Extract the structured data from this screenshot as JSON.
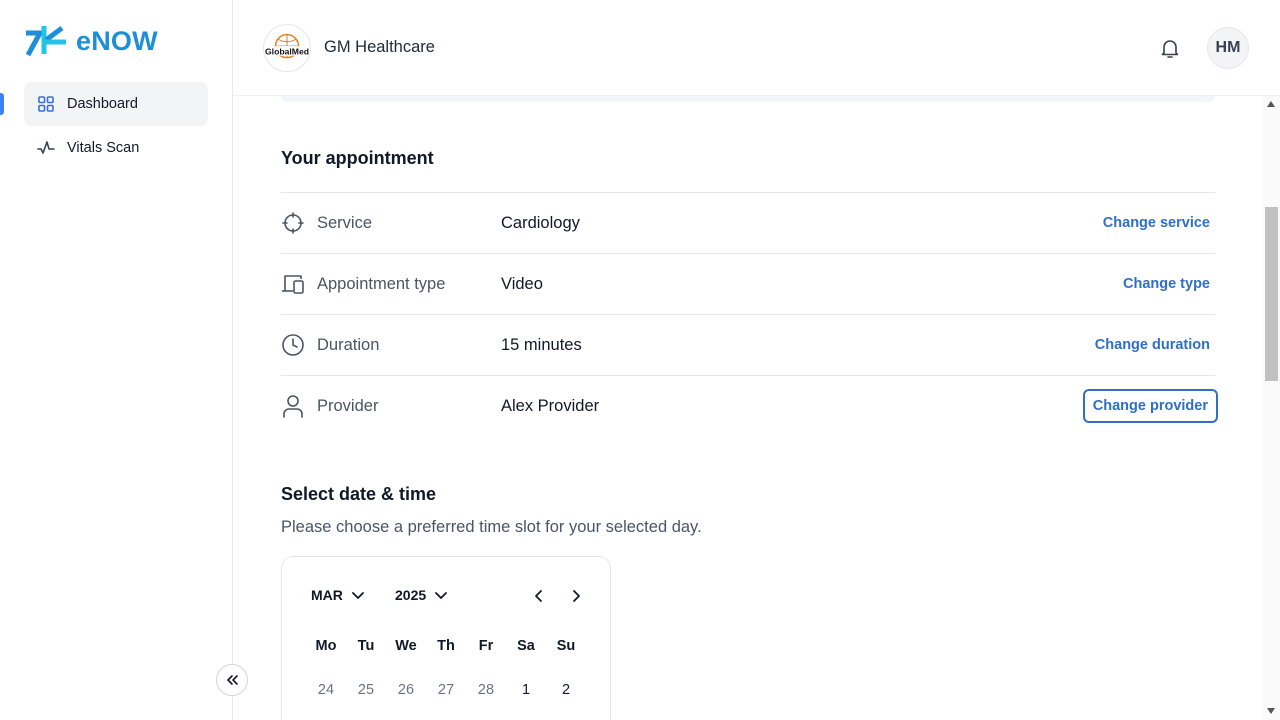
{
  "brand": {
    "name": "eNOW",
    "color": "#1d8fd9"
  },
  "sidebar": {
    "items": [
      {
        "label": "Dashboard",
        "icon": "dashboard-grid-icon",
        "active": true
      },
      {
        "label": "Vitals Scan",
        "icon": "pulse-icon",
        "active": false
      }
    ],
    "collapse_icon": "double-chevron-left-icon"
  },
  "header": {
    "org_name": "GM Healthcare",
    "org_logo_text": "GlobalMed",
    "notification_icon": "bell-icon",
    "avatar_initials": "HM"
  },
  "appointment": {
    "title": "Your appointment",
    "rows": [
      {
        "label": "Service",
        "value": "Cardiology",
        "action": "Change service",
        "icon": "crosshair-icon"
      },
      {
        "label": "Appointment type",
        "value": "Video",
        "action": "Change type",
        "icon": "devices-icon"
      },
      {
        "label": "Duration",
        "value": "15 minutes",
        "action": "Change duration",
        "icon": "clock-icon"
      },
      {
        "label": "Provider",
        "value": "Alex Provider",
        "action": "Change provider",
        "icon": "user-icon",
        "focused": true
      }
    ]
  },
  "schedule": {
    "title": "Select date & time",
    "subtitle": "Please choose a preferred time slot for your selected day.",
    "calendar": {
      "month": "MAR",
      "year": "2025",
      "weekdays": [
        "Mo",
        "Tu",
        "We",
        "Th",
        "Fr",
        "Sa",
        "Su"
      ],
      "first_row": [
        "24",
        "25",
        "26",
        "27",
        "28",
        "1",
        "2"
      ],
      "first_row_current_month": [
        false,
        false,
        false,
        false,
        false,
        true,
        true
      ]
    }
  },
  "colors": {
    "accent": "#2f6fc6",
    "active_marker": "#3b82f6"
  }
}
